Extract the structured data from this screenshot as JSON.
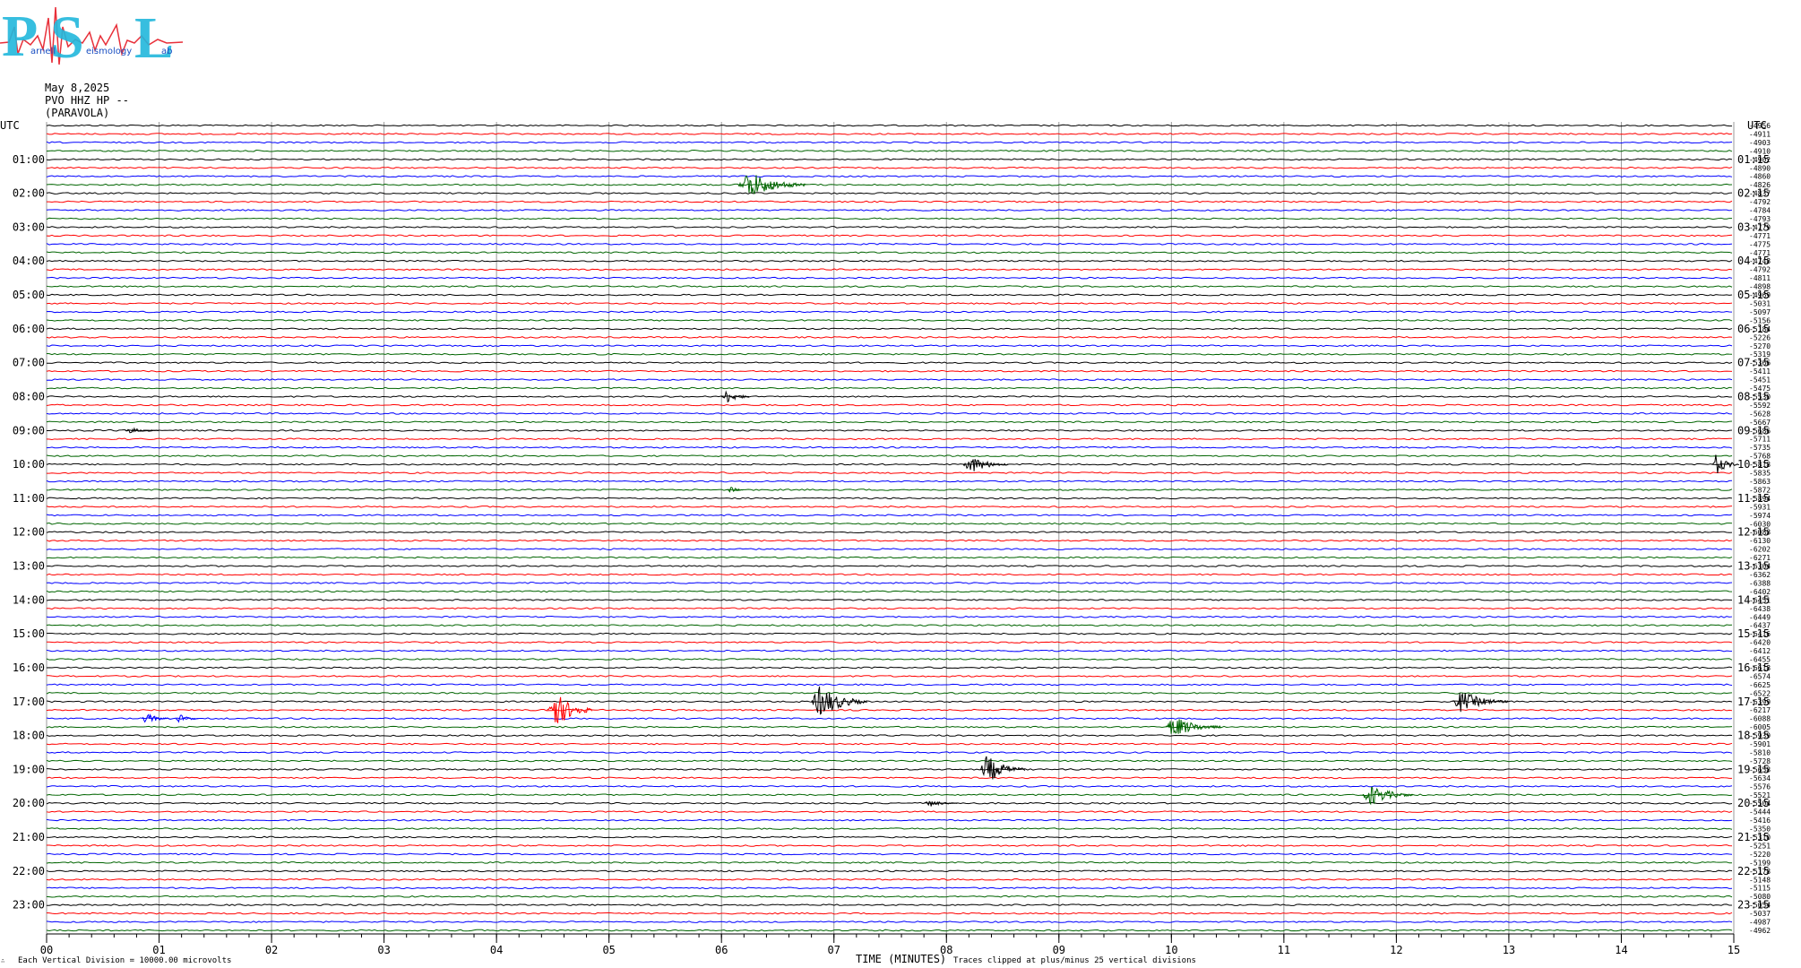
{
  "logo": {
    "letters": [
      "P",
      "S",
      "L"
    ],
    "small_words": [
      "arnell",
      "eismology",
      "ab"
    ],
    "colors": {
      "big_letters": "#22b8dc",
      "seismo_line": "#e8303a",
      "small_text": "#1a4fc2"
    }
  },
  "header": {
    "date": "May 8,2025",
    "station": "PVO HHZ HP --",
    "location": "(PARAVOLA)"
  },
  "footer": {
    "scale_note": "Each Vertical Division = 10000.00 microvolts",
    "clip_note": "Traces clipped at plus/minus 25 vertical divisions",
    "mini_mark": "∴"
  },
  "chart_data": {
    "type": "line",
    "title": "",
    "xlabel": "TIME (MINUTES)",
    "ylabel": "",
    "xlim": [
      0,
      15
    ],
    "x_ticks": [
      "00",
      "01",
      "02",
      "03",
      "04",
      "05",
      "06",
      "07",
      "08",
      "09",
      "10",
      "11",
      "12",
      "13",
      "14",
      "15"
    ],
    "left_axis_title": "UTC",
    "right_axis_title": "UTC",
    "left_hour_labels": [
      "01:00",
      "02:00",
      "03:00",
      "04:00",
      "05:00",
      "06:00",
      "07:00",
      "08:00",
      "09:00",
      "10:00",
      "11:00",
      "12:00",
      "13:00",
      "14:00",
      "15:00",
      "16:00",
      "17:00",
      "18:00",
      "19:00",
      "20:00",
      "21:00",
      "22:00",
      "23:00"
    ],
    "right_hour_labels": [
      "01:15",
      "02:15",
      "03:15",
      "04:15",
      "05:15",
      "06:15",
      "07:15",
      "08:15",
      "09:15",
      "10:15",
      "11:15",
      "12:15",
      "13:15",
      "14:15",
      "15:15",
      "16:15",
      "17:15",
      "18:15",
      "19:15",
      "20:15",
      "21:15",
      "22:15",
      "23:15"
    ],
    "trace_colors": [
      "#000000",
      "#ff0000",
      "#0000ff",
      "#006400"
    ],
    "trace_count": 96,
    "trace_offsets": [
      -4956,
      -4911,
      -4903,
      -4910,
      -4902,
      -4890,
      -4860,
      -4826,
      -4837,
      -4792,
      -4784,
      -4793,
      -4779,
      -4771,
      -4775,
      -4771,
      -4748,
      -4792,
      -4811,
      -4898,
      -4969,
      -5031,
      -5097,
      -5156,
      -5184,
      -5226,
      -5270,
      -5319,
      -5366,
      -5411,
      -5451,
      -5475,
      -5530,
      -5592,
      -5628,
      -5667,
      -5686,
      -5711,
      -5735,
      -5768,
      -5818,
      -5835,
      -5863,
      -5872,
      -5894,
      -5931,
      -5974,
      -6030,
      -6088,
      -6130,
      -6202,
      -6271,
      -6304,
      -6362,
      -6388,
      -6402,
      -6451,
      -6438,
      -6449,
      -6437,
      -6416,
      -6420,
      -6412,
      -6455,
      -6618,
      -6574,
      -6625,
      -6522,
      -6399,
      -6217,
      -6088,
      -6005,
      -5939,
      -5901,
      -5810,
      -5728,
      -5658,
      -5634,
      -5576,
      -5521,
      -5504,
      -5444,
      -5416,
      -5350,
      -5310,
      -5251,
      -5220,
      -5199,
      -5178,
      -5148,
      -5115,
      -5080,
      -5054,
      -5037,
      -4987,
      -4962
    ],
    "events": [
      {
        "trace": 7,
        "minute": 6.15,
        "amplitude": 0.8,
        "duration": 0.6
      },
      {
        "trace": 32,
        "minute": 6.0,
        "amplitude": 0.4,
        "duration": 0.25
      },
      {
        "trace": 36,
        "minute": 0.7,
        "amplitude": 0.15,
        "duration": 0.3
      },
      {
        "trace": 40,
        "minute": 8.15,
        "amplitude": 0.5,
        "duration": 0.4
      },
      {
        "trace": 40,
        "minute": 14.8,
        "amplitude": 0.6,
        "duration": 0.25
      },
      {
        "trace": 43,
        "minute": 6.05,
        "amplitude": 0.2,
        "duration": 0.15
      },
      {
        "trace": 68,
        "minute": 6.8,
        "amplitude": 0.9,
        "duration": 0.5
      },
      {
        "trace": 68,
        "minute": 12.5,
        "amplitude": 0.6,
        "duration": 0.5
      },
      {
        "trace": 69,
        "minute": 4.45,
        "amplitude": 1.1,
        "duration": 0.4
      },
      {
        "trace": 70,
        "minute": 0.85,
        "amplitude": 0.3,
        "duration": 0.25
      },
      {
        "trace": 70,
        "minute": 1.15,
        "amplitude": 0.25,
        "duration": 0.2
      },
      {
        "trace": 71,
        "minute": 9.95,
        "amplitude": 0.6,
        "duration": 0.5
      },
      {
        "trace": 76,
        "minute": 8.3,
        "amplitude": 0.8,
        "duration": 0.4
      },
      {
        "trace": 79,
        "minute": 11.7,
        "amplitude": 0.6,
        "duration": 0.45
      },
      {
        "trace": 80,
        "minute": 7.8,
        "amplitude": 0.2,
        "duration": 0.3
      }
    ],
    "grid": true
  }
}
